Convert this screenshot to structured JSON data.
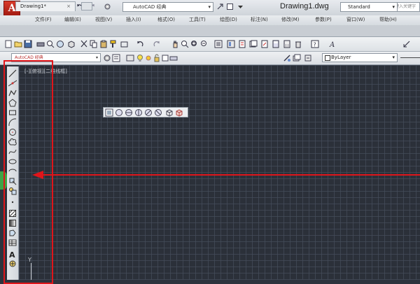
{
  "app": {
    "logo_letter": "A",
    "drawing_title": "Drawing1.dwg",
    "workspace": "AutoCAD 经典",
    "search_placeholder": "键入关键字"
  },
  "menu": {
    "items": [
      "文件(F)",
      "编辑(E)",
      "视图(V)",
      "插入(I)",
      "格式(O)",
      "工具(T)",
      "绘图(D)",
      "标注(N)",
      "修改(M)",
      "参数(P)",
      "窗口(W)",
      "帮助(H)"
    ]
  },
  "tabs": {
    "file_tab": "Drawing1*",
    "close_glyph": "×"
  },
  "toolbar": {
    "text_style": "Standard",
    "layer": "AutoCAD 经典",
    "color": "ByLayer"
  },
  "canvas": {
    "viewport_label": "[-][俯视][二维线框]",
    "ucs_y": "Y"
  },
  "colors": {
    "annotation_red": "#e0151a",
    "canvas_bg": "#2b3039",
    "logo_red": "#c62b1e"
  },
  "icons": {
    "draw_toolbar": [
      "line-icon",
      "construction-line-icon",
      "polyline-icon",
      "polygon-icon",
      "rectangle-icon",
      "arc-icon",
      "circle-icon",
      "revision-cloud-icon",
      "spline-icon",
      "ellipse-icon",
      "ellipse-arc-icon",
      "insert-block-icon",
      "make-block-icon",
      "point-icon",
      "hatch-icon",
      "gradient-icon",
      "region-icon",
      "table-icon",
      "multiline-text-icon",
      "add-selected-icon"
    ],
    "floating_toolbar": [
      "view-top-icon",
      "view-bottom-icon",
      "view-left-icon",
      "view-right-icon",
      "view-front-icon",
      "view-back-icon",
      "view-sw-iso-icon",
      "view-se-iso-icon"
    ]
  }
}
